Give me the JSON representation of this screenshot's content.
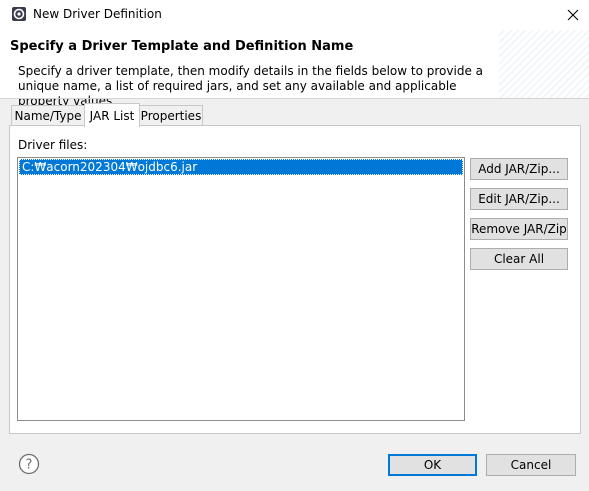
{
  "window": {
    "title": "New Driver Definition",
    "icon": "eclipse-gear-icon"
  },
  "header": {
    "title": "Specify a Driver Template and Definition Name",
    "description": "Specify a driver template, then modify details in the fields below to provide a unique name, a list of required jars, and set any available and applicable property values."
  },
  "tabs": [
    {
      "label": "Name/Type",
      "active": false
    },
    {
      "label": "JAR List",
      "active": true
    },
    {
      "label": "Properties",
      "active": false
    }
  ],
  "jar_list": {
    "label": "Driver files:",
    "items": [
      {
        "path": "C:₩acorn202304₩ojdbc6.jar",
        "selected": true
      }
    ]
  },
  "side_buttons": {
    "add": "Add JAR/Zip...",
    "edit": "Edit JAR/Zip...",
    "remove": "Remove JAR/Zip",
    "clear": "Clear All"
  },
  "footer": {
    "ok": "OK",
    "cancel": "Cancel"
  },
  "colors": {
    "selection": "#0078d7",
    "default_button_border": "#0078d7"
  }
}
